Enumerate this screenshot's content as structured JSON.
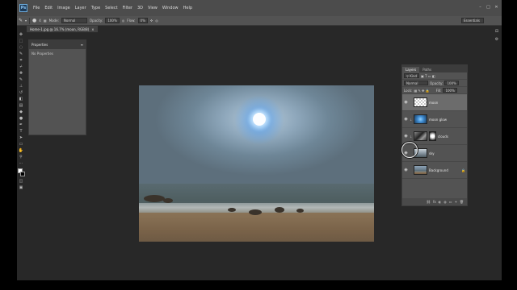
{
  "app": {
    "logo": "Ps"
  },
  "menu": [
    "File",
    "Edit",
    "Image",
    "Layer",
    "Type",
    "Select",
    "Filter",
    "3D",
    "View",
    "Window",
    "Help"
  ],
  "window_controls": [
    "–",
    "□",
    "✕"
  ],
  "options": {
    "brush_size": "4",
    "mode_label": "Mode:",
    "mode_value": "Normal",
    "opacity_label": "Opacity:",
    "opacity_value": "100%",
    "flow_label": "Flow:",
    "flow_value": "0%"
  },
  "workspace": "Essentials",
  "document_tab": {
    "title": "Home-1.jpg @ 16.7% (moon, RGB/8)",
    "close": "×"
  },
  "properties": {
    "title": "Properties",
    "close": "≡",
    "body": "No Properties"
  },
  "side_icons": [
    "⊟",
    "⚙"
  ],
  "layers_panel": {
    "tabs": [
      "Layers",
      "Paths"
    ],
    "kind_label": "Kind",
    "blend_mode": "Normal",
    "opacity_label": "Opacity:",
    "opacity_value": "100%",
    "lock_label": "Lock:",
    "fill_label": "Fill:",
    "fill_value": "100%",
    "layers": [
      {
        "name": "moon",
        "visible": true,
        "selected": true,
        "thumb": "checker"
      },
      {
        "name": "moon glow",
        "visible": true,
        "selected": false,
        "thumb": "glow"
      },
      {
        "name": "clouds",
        "visible": true,
        "selected": false,
        "thumb": "clouds"
      },
      {
        "name": "sky",
        "visible": true,
        "selected": false,
        "thumb": "sky"
      },
      {
        "name": "Background",
        "visible": true,
        "selected": false,
        "thumb": "beach",
        "locked": true
      }
    ],
    "footer_icons": [
      "⛓",
      "fx",
      "◐",
      "◍",
      "▭",
      "+",
      "🗑"
    ]
  },
  "colors": {
    "accent": "#3f8bd0",
    "panel": "#535353",
    "canvas_bg": "#282828"
  }
}
